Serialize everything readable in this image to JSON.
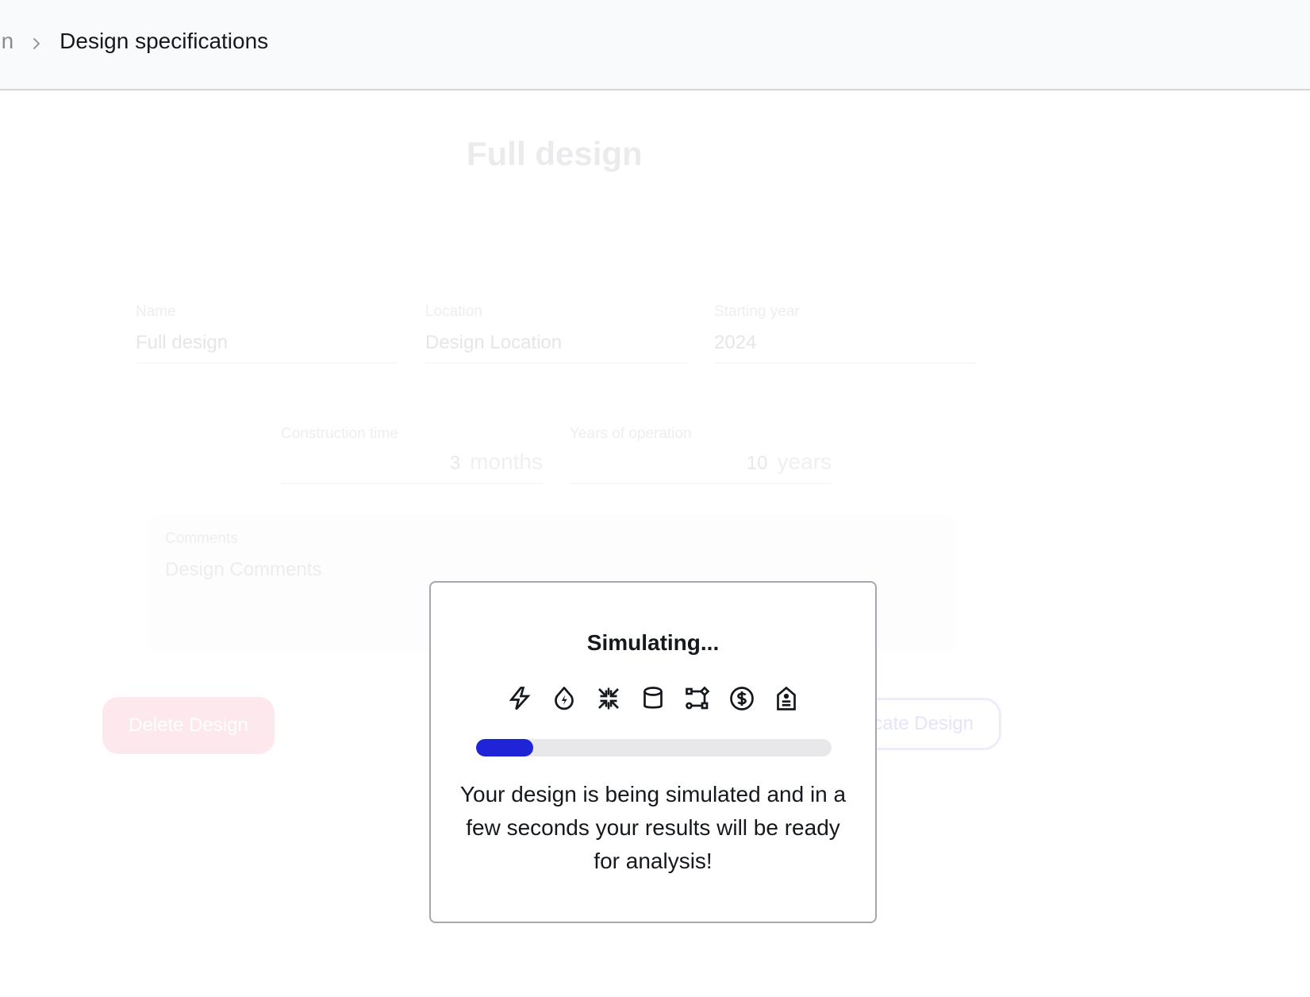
{
  "header": {
    "breadcrumb": [
      {
        "label": "Design",
        "visible_fragment": "gn"
      },
      {
        "label": "Design specifications"
      }
    ],
    "separator_icon": "chevron-right-icon"
  },
  "form": {
    "title": "Full design",
    "name": {
      "label": "Name",
      "value": "Full design"
    },
    "location": {
      "label": "Location",
      "placeholder": "Design Location"
    },
    "starting_year": {
      "label": "Starting year",
      "value": "2024"
    },
    "construction_time": {
      "label": "Construction time",
      "value": "3",
      "unit": "months"
    },
    "years_of_operation": {
      "label": "Years of operation",
      "value": "10",
      "unit": "years"
    },
    "comments": {
      "label": "Comments",
      "placeholder": "Design Comments"
    },
    "delete_button": "Delete Design",
    "duplicate_button": "cate Design"
  },
  "modal": {
    "title": "Simulating...",
    "icons": [
      "bolt-icon",
      "water-energy-icon",
      "compress-arrows-icon",
      "database-cylinder-icon",
      "network-nodes-icon",
      "dollar-circle-icon",
      "price-tag-icon"
    ],
    "progress_percent": 16,
    "progress_color": "#1f24d6",
    "message": "Your design is being simulated and in a few seconds your results will be ready for analysis!"
  }
}
